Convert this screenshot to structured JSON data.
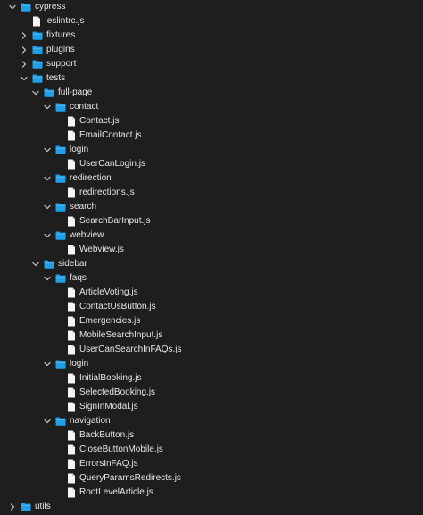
{
  "colors": {
    "background": "#1e1e1e",
    "folder": "#1fa0e8",
    "file_page": "#f4f4f4",
    "text": "#e6e6e6",
    "chevron": "#b8b8b8"
  },
  "tree": [
    {
      "label": "cypress",
      "type": "folder",
      "depth": 0,
      "expanded": true
    },
    {
      "label": ".eslintrc.js",
      "type": "file",
      "depth": 1
    },
    {
      "label": "fixtures",
      "type": "folder",
      "depth": 1,
      "expanded": false
    },
    {
      "label": "plugins",
      "type": "folder",
      "depth": 1,
      "expanded": false
    },
    {
      "label": "support",
      "type": "folder",
      "depth": 1,
      "expanded": false
    },
    {
      "label": "tests",
      "type": "folder",
      "depth": 1,
      "expanded": true
    },
    {
      "label": "full-page",
      "type": "folder",
      "depth": 2,
      "expanded": true
    },
    {
      "label": "contact",
      "type": "folder",
      "depth": 3,
      "expanded": true
    },
    {
      "label": "Contact.js",
      "type": "file",
      "depth": 4
    },
    {
      "label": "EmailContact.js",
      "type": "file",
      "depth": 4
    },
    {
      "label": "login",
      "type": "folder",
      "depth": 3,
      "expanded": true
    },
    {
      "label": "UserCanLogin.js",
      "type": "file",
      "depth": 4
    },
    {
      "label": "redirection",
      "type": "folder",
      "depth": 3,
      "expanded": true
    },
    {
      "label": "redirections.js",
      "type": "file",
      "depth": 4
    },
    {
      "label": "search",
      "type": "folder",
      "depth": 3,
      "expanded": true
    },
    {
      "label": "SearchBarInput.js",
      "type": "file",
      "depth": 4
    },
    {
      "label": "webview",
      "type": "folder",
      "depth": 3,
      "expanded": true
    },
    {
      "label": "Webview.js",
      "type": "file",
      "depth": 4
    },
    {
      "label": "sidebar",
      "type": "folder",
      "depth": 2,
      "expanded": true
    },
    {
      "label": "faqs",
      "type": "folder",
      "depth": 3,
      "expanded": true
    },
    {
      "label": "ArticleVoting.js",
      "type": "file",
      "depth": 4
    },
    {
      "label": "ContactUsButton.js",
      "type": "file",
      "depth": 4
    },
    {
      "label": "Emergencies.js",
      "type": "file",
      "depth": 4
    },
    {
      "label": "MobileSearchInput.js",
      "type": "file",
      "depth": 4
    },
    {
      "label": "UserCanSearchInFAQs.js",
      "type": "file",
      "depth": 4
    },
    {
      "label": "login",
      "type": "folder",
      "depth": 3,
      "expanded": true
    },
    {
      "label": "InitialBooking.js",
      "type": "file",
      "depth": 4
    },
    {
      "label": "SelectedBooking.js",
      "type": "file",
      "depth": 4
    },
    {
      "label": "SignInModal.js",
      "type": "file",
      "depth": 4
    },
    {
      "label": "navigation",
      "type": "folder",
      "depth": 3,
      "expanded": true
    },
    {
      "label": "BackButton.js",
      "type": "file",
      "depth": 4
    },
    {
      "label": "CloseButtonMobile.js",
      "type": "file",
      "depth": 4
    },
    {
      "label": "ErrorsInFAQ.js",
      "type": "file",
      "depth": 4
    },
    {
      "label": "QueryParamsRedirects.js",
      "type": "file",
      "depth": 4
    },
    {
      "label": "RootLevelArticle.js",
      "type": "file",
      "depth": 4
    },
    {
      "label": "utils",
      "type": "folder",
      "depth": 0,
      "expanded": false
    }
  ]
}
